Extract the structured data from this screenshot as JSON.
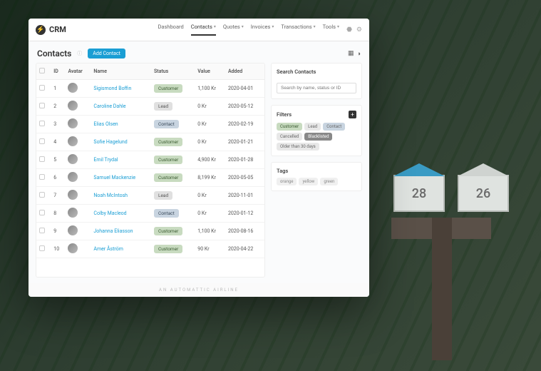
{
  "brand": "CRM",
  "nav": {
    "dashboard": "Dashboard",
    "contacts": "Contacts",
    "quotes": "Quotes",
    "invoices": "Invoices",
    "transactions": "Transactions",
    "tools": "Tools"
  },
  "page": {
    "title": "Contacts",
    "add_button": "Add Contact"
  },
  "table": {
    "headers": {
      "id": "ID",
      "avatar": "Avatar",
      "name": "Name",
      "status": "Status",
      "value": "Value",
      "added": "Added"
    },
    "rows": [
      {
        "id": "1",
        "name": "Sigismond Boffin",
        "status": "Customer",
        "status_class": "customer",
        "value": "1,100 Kr",
        "added": "2020-04-01"
      },
      {
        "id": "2",
        "name": "Caroline Dahle",
        "status": "Lead",
        "status_class": "lead",
        "value": "0 Kr",
        "added": "2020-05-12"
      },
      {
        "id": "3",
        "name": "Elias Olsen",
        "status": "Contact",
        "status_class": "contact",
        "value": "0 Kr",
        "added": "2020-02-19"
      },
      {
        "id": "4",
        "name": "Sofie Hagelund",
        "status": "Customer",
        "status_class": "customer",
        "value": "0 Kr",
        "added": "2020-01-21"
      },
      {
        "id": "5",
        "name": "Emil Trydal",
        "status": "Customer",
        "status_class": "customer",
        "value": "4,900 Kr",
        "added": "2020-01-28"
      },
      {
        "id": "6",
        "name": "Samuel Mackenzie",
        "status": "Customer",
        "status_class": "customer",
        "value": "8,199 Kr",
        "added": "2020-05-05"
      },
      {
        "id": "7",
        "name": "Noah McIntosh",
        "status": "Lead",
        "status_class": "lead",
        "value": "0 Kr",
        "added": "2020-11-01"
      },
      {
        "id": "8",
        "name": "Colby Macleod",
        "status": "Contact",
        "status_class": "contact",
        "value": "0 Kr",
        "added": "2020-01-12"
      },
      {
        "id": "9",
        "name": "Johanna Eliasson",
        "status": "Customer",
        "status_class": "customer",
        "value": "1,100 Kr",
        "added": "2020-08-16"
      },
      {
        "id": "10",
        "name": "Amer Åström",
        "status": "Customer",
        "status_class": "customer",
        "value": "90 Kr",
        "added": "2020-04-22"
      }
    ]
  },
  "sidebar": {
    "search_title": "Search Contacts",
    "search_placeholder": "Search by name, status or ID",
    "filters_title": "Filters",
    "filters": {
      "customer": "Customer",
      "lead": "Lead",
      "contact": "Contact",
      "cancelled": "Cancelled",
      "blacklisted": "Blacklisted",
      "older": "Older than 30 days"
    },
    "tags_title": "Tags",
    "tags": {
      "orange": "orange",
      "yellow": "yellow",
      "green": "green"
    }
  },
  "footer": "AN AUTOMATTIC AIRLINE",
  "mailbox": {
    "a": "28",
    "b": "26"
  }
}
